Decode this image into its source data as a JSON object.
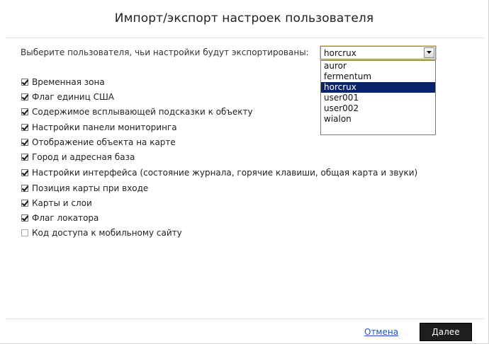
{
  "dialog": {
    "title": "Импорт/экспорт настроек пользователя"
  },
  "user_select": {
    "label": "Выберите пользователя, чьи настройки будут экспортированы:",
    "value": "horcrux",
    "open": true,
    "options": [
      "auror",
      "fermentum",
      "horcrux",
      "user001",
      "user002",
      "wialon"
    ],
    "selected_index": 2,
    "highlight_color": "#0a246a"
  },
  "settings": [
    {
      "label": "Временная зона",
      "checked": true
    },
    {
      "label": "Флаг единиц США",
      "checked": true
    },
    {
      "label": "Содержимое всплывающей подсказки к объекту",
      "checked": true
    },
    {
      "label": "Настройки панели мониторинга",
      "checked": true
    },
    {
      "label": "Отображение объекта на карте",
      "checked": true
    },
    {
      "label": "Город и адресная база",
      "checked": true
    },
    {
      "label": "Настройки интерфейса (состояние журнала, горячие клавиши, общая карта и звуки)",
      "checked": true
    },
    {
      "label": "Позиция карты при входе",
      "checked": true
    },
    {
      "label": "Карты и слои",
      "checked": true
    },
    {
      "label": "Флаг локатора",
      "checked": true
    },
    {
      "label": "Код доступа к мобильному сайту",
      "checked": false
    }
  ],
  "footer": {
    "cancel_label": "Отмена",
    "next_label": "Далее",
    "link_color": "#1a56b8",
    "button_color": "#1e1e1e"
  }
}
